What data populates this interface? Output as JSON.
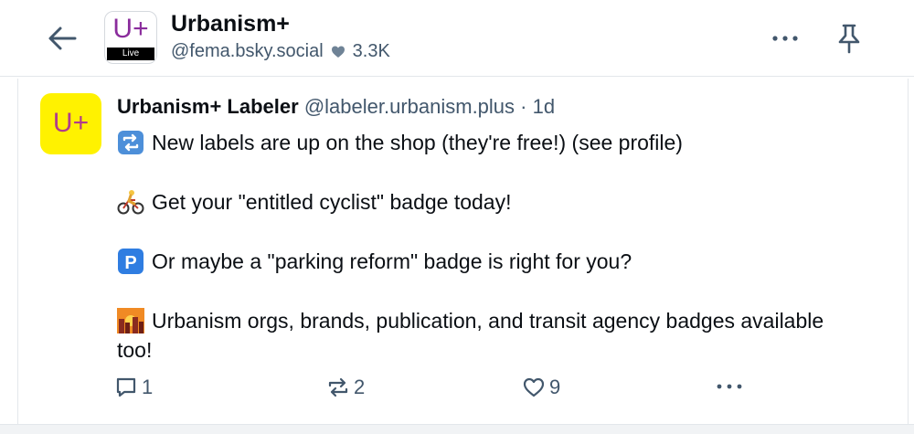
{
  "header": {
    "feed_avatar_text": "U+",
    "feed_avatar_badge": "Live",
    "title": "Urbanism+",
    "handle": "@fema.bsky.social",
    "likes": "3.3K"
  },
  "post": {
    "avatar_text": "U+",
    "author_name": "Urbanism+ Labeler",
    "author_handle": "@labeler.urbanism.plus",
    "separator": "·",
    "time": "1d",
    "lines": [
      {
        "icon": "repost-emoji-icon",
        "text": "New labels are up on the shop (they're free!) (see profile)"
      },
      {
        "icon": "cyclist-emoji-icon",
        "text": "Get your \"entitled cyclist\" badge today!"
      },
      {
        "icon": "parking-emoji-icon",
        "text": "Or maybe a \"parking reform\" badge is right for you?"
      },
      {
        "icon": "city-sunset-emoji-icon",
        "text": "Urbanism orgs, brands, publication, and transit agency badges available too!"
      }
    ],
    "actions": {
      "replies": "1",
      "reposts": "2",
      "likes": "9"
    }
  },
  "colors": {
    "muted": "#42576c",
    "brand_purple": "#8a2c9c",
    "labeler_yellow": "#fff200"
  }
}
